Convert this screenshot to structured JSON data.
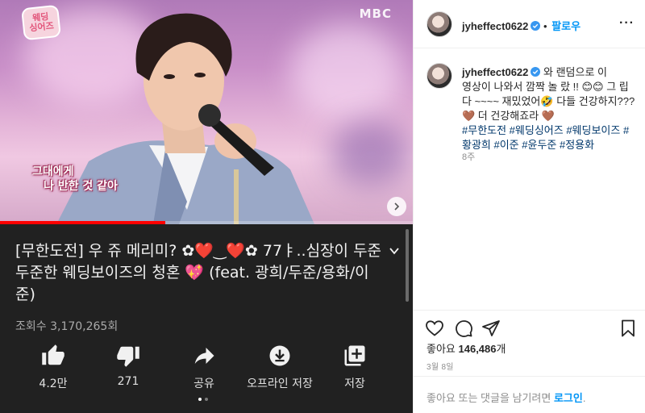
{
  "video": {
    "show_logo": "웨딩\n싱어즈",
    "broadcaster": "MBC",
    "caption_line1": "그대에게",
    "caption_line2": "나 반한 것 같아",
    "progress_fraction": 0.4
  },
  "youtube": {
    "title": "[무한도전] 우 쥬 메리미? ✿❤️‿❤️✿ 77ㅑ..심장이 두준두준한 웨딩보이즈의 청혼 💖 (feat. 광희/두준/용화/이준)",
    "views": "조회수 3,170,265회",
    "actions": [
      {
        "icon": "thumbs-up-icon",
        "label": "4.2만"
      },
      {
        "icon": "thumbs-down-icon",
        "label": "271"
      },
      {
        "icon": "share-icon",
        "label": "공유"
      },
      {
        "icon": "download-icon",
        "label": "오프라인 저장"
      },
      {
        "icon": "save-playlist-icon",
        "label": "저장"
      }
    ]
  },
  "post": {
    "username": "jyheffect0622",
    "follow_label": "팔로우",
    "more_label": "···",
    "caption": "와 랜덤으로 이 영상이 나와서 깜짝 놀 랐 !! 😊😊 그 립 다 ~~~~ 재밌었어🤣 다들 건강하지??? 🤎 더 건강해죠라 🤎",
    "hashtags": "#무한도전 #웨딩싱어즈 #웨딩보이즈 #황광희 #이준 #윤두준 #정용화",
    "time_ago": "8주",
    "likes_prefix": "좋아요 ",
    "likes_count": "146,486",
    "likes_suffix": "개",
    "date": "3월 8일",
    "footer_text": "좋아요 또는 댓글을 남기려면 ",
    "footer_login": "로그인",
    "footer_end": "."
  },
  "colors": {
    "accent": "#0095f6",
    "progress_red": "#ff0000",
    "youtube_bg": "#212121",
    "hashtag": "#00376b"
  }
}
